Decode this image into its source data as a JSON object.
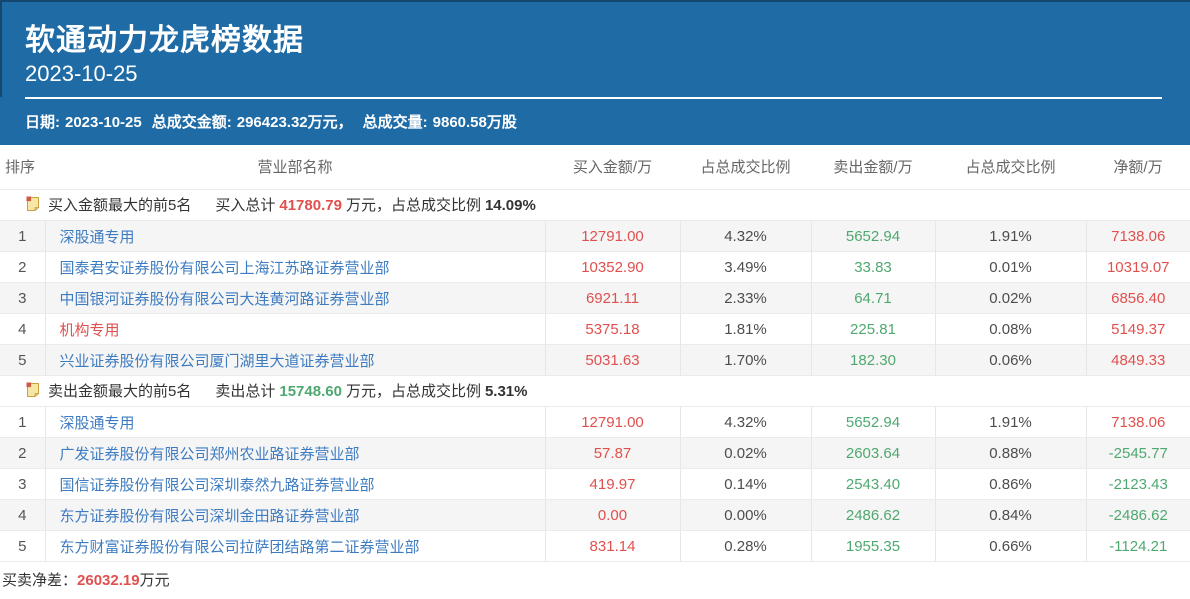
{
  "header": {
    "title": "软通动力龙虎榜数据",
    "date": "2023-10-25"
  },
  "summary": {
    "date_label": "日期:",
    "date": "2023-10-25",
    "turnover_label": "总成交金额:",
    "turnover": "296423.32万元，",
    "volume_label": "总成交量:",
    "volume": "9860.58万股"
  },
  "table": {
    "columns": [
      "排序",
      "营业部名称",
      "买入金额/万",
      "占总成交比例",
      "卖出金额/万",
      "占总成交比例",
      "净额/万"
    ],
    "sections": [
      {
        "icon": "note-icon",
        "title": "买入金额最大的前5名",
        "total_label": "买入总计",
        "total_value": "41780.79",
        "total_suffix": "万元，占总成交比例",
        "total_pct": "14.09%",
        "total_class": "red",
        "rows": [
          {
            "rank": "1",
            "name": "深股通专用",
            "name_class": "blue",
            "buy": "12791.00",
            "buy_pct": "4.32%",
            "sell": "5652.94",
            "sell_pct": "1.91%",
            "net": "7138.06",
            "net_class": "red"
          },
          {
            "rank": "2",
            "name": "国泰君安证券股份有限公司上海江苏路证券营业部",
            "name_class": "blue",
            "buy": "10352.90",
            "buy_pct": "3.49%",
            "sell": "33.83",
            "sell_pct": "0.01%",
            "net": "10319.07",
            "net_class": "red"
          },
          {
            "rank": "3",
            "name": "中国银河证券股份有限公司大连黄河路证券营业部",
            "name_class": "blue",
            "buy": "6921.11",
            "buy_pct": "2.33%",
            "sell": "64.71",
            "sell_pct": "0.02%",
            "net": "6856.40",
            "net_class": "red"
          },
          {
            "rank": "4",
            "name": "机构专用",
            "name_class": "red",
            "buy": "5375.18",
            "buy_pct": "1.81%",
            "sell": "225.81",
            "sell_pct": "0.08%",
            "net": "5149.37",
            "net_class": "red"
          },
          {
            "rank": "5",
            "name": "兴业证券股份有限公司厦门湖里大道证券营业部",
            "name_class": "blue",
            "buy": "5031.63",
            "buy_pct": "1.70%",
            "sell": "182.30",
            "sell_pct": "0.06%",
            "net": "4849.33",
            "net_class": "red"
          }
        ]
      },
      {
        "icon": "note-icon",
        "title": "卖出金额最大的前5名",
        "total_label": "卖出总计",
        "total_value": "15748.60",
        "total_suffix": "万元，占总成交比例",
        "total_pct": "5.31%",
        "total_class": "green",
        "rows": [
          {
            "rank": "1",
            "name": "深股通专用",
            "name_class": "blue",
            "buy": "12791.00",
            "buy_pct": "4.32%",
            "sell": "5652.94",
            "sell_pct": "1.91%",
            "net": "7138.06",
            "net_class": "red"
          },
          {
            "rank": "2",
            "name": "广发证券股份有限公司郑州农业路证券营业部",
            "name_class": "blue",
            "buy": "57.87",
            "buy_pct": "0.02%",
            "sell": "2603.64",
            "sell_pct": "0.88%",
            "net": "-2545.77",
            "net_class": "green"
          },
          {
            "rank": "3",
            "name": "国信证券股份有限公司深圳泰然九路证券营业部",
            "name_class": "blue",
            "buy": "419.97",
            "buy_pct": "0.14%",
            "sell": "2543.40",
            "sell_pct": "0.86%",
            "net": "-2123.43",
            "net_class": "green"
          },
          {
            "rank": "4",
            "name": "东方证券股份有限公司深圳金田路证券营业部",
            "name_class": "blue",
            "buy": "0.00",
            "buy_pct": "0.00%",
            "sell": "2486.62",
            "sell_pct": "0.84%",
            "net": "-2486.62",
            "net_class": "green"
          },
          {
            "rank": "5",
            "name": "东方财富证券股份有限公司拉萨团结路第二证券营业部",
            "name_class": "blue",
            "buy": "831.14",
            "buy_pct": "0.28%",
            "sell": "1955.35",
            "sell_pct": "0.66%",
            "net": "-1124.21",
            "net_class": "green"
          }
        ]
      }
    ]
  },
  "footer": {
    "label": "买卖净差：",
    "value": "26032.19",
    "unit": "万元"
  },
  "colors": {
    "header_bg": "#1e6ba6",
    "header_border": "#16486f",
    "red": "#e0504e",
    "green": "#4fa870",
    "link_blue": "#3e7cc1",
    "stripe": "#f5f5f5"
  }
}
